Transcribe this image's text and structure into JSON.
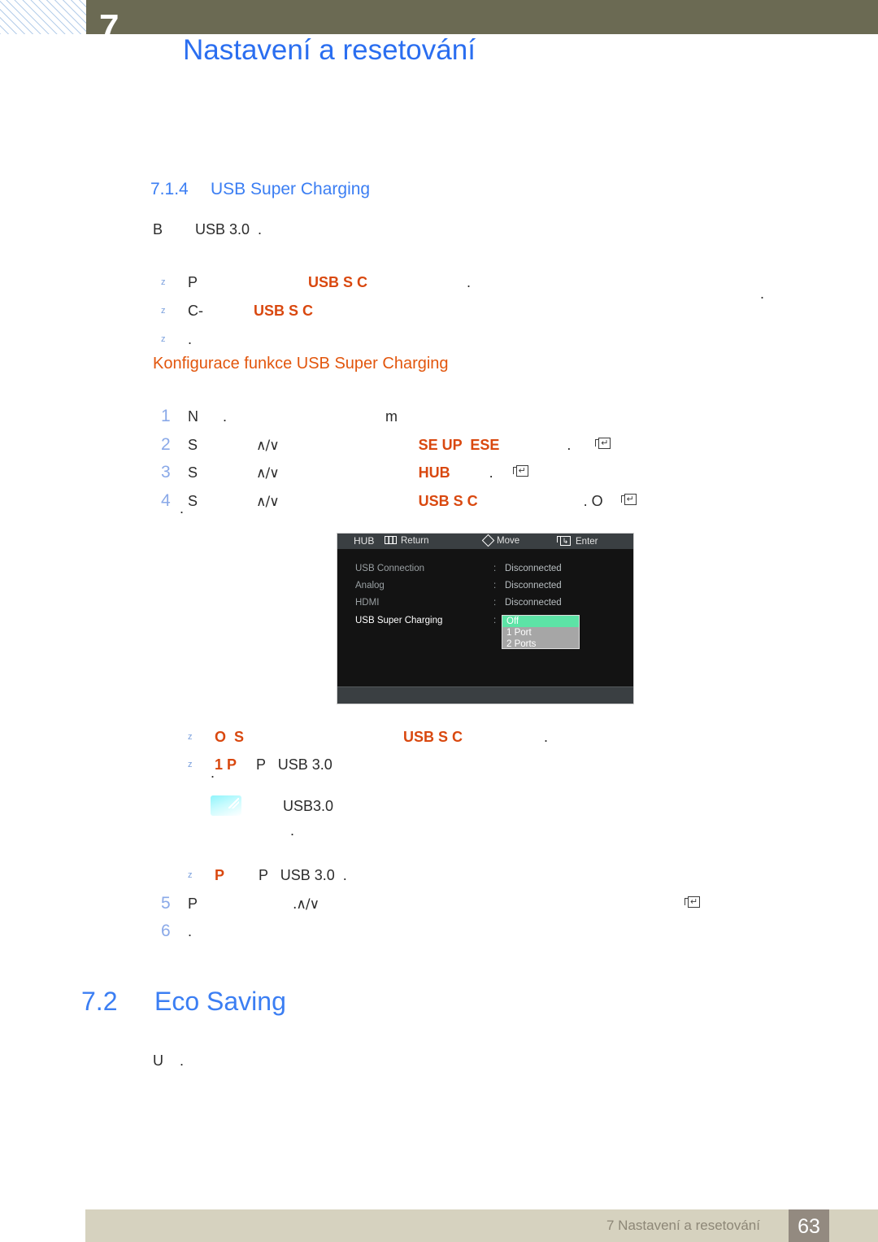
{
  "header": {
    "chapter_number": "7",
    "title": "Nastavení a resetování"
  },
  "section": {
    "number": "7.1.4",
    "title": "USB Super Charging",
    "intro": "B        USB 3.0  ."
  },
  "bullets_top": [
    {
      "mark": "z",
      "pre": "P",
      "accent": "USB S C",
      "post": "."
    },
    {
      "mark": "z",
      "pre": "C-",
      "accent": "USB S C",
      "post": ""
    },
    {
      "mark": "z",
      "pre": "",
      "accent": "",
      "post": "."
    }
  ],
  "bullets_top_tail": {
    "line2_tail": ".",
    "line3_tail": "."
  },
  "procedure": {
    "title": "Konfigurace funkce USB Super Charging",
    "steps": [
      {
        "num": "1",
        "a": "N      .",
        "glyph": "",
        "b": "m",
        "accent": "",
        "tail": "",
        "enter": false
      },
      {
        "num": "2",
        "a": "S",
        "glyph": "∧/∨",
        "b": "",
        "accent": "SE UP  ESE",
        "tail": ".",
        "enter": true
      },
      {
        "num": "3",
        "a": "S",
        "glyph": "∧/∨",
        "b": "",
        "accent": "HUB",
        "tail": ".",
        "enter": true
      },
      {
        "num": "4",
        "a": "S",
        "glyph": "∧/∨",
        "b": "",
        "accent": "USB S C",
        "tail": ". O",
        "enter": true
      },
      {
        "num": "",
        "a": ".",
        "glyph": "",
        "b": "",
        "accent": "",
        "tail": "",
        "enter": false
      }
    ],
    "steps_tail": [
      {
        "num": "5",
        "a": "P",
        "glyph": ".∧/∨",
        "accent": "",
        "tail": "",
        "enter": true
      },
      {
        "num": "6",
        "a": ".",
        "glyph": "",
        "accent": "",
        "tail": "",
        "enter": false
      }
    ]
  },
  "osd": {
    "title": "HUB",
    "rows": [
      {
        "label": "USB Connection",
        "colon": ":",
        "value": "Disconnected",
        "active": false
      },
      {
        "label": "Analog",
        "colon": ":",
        "value": "Disconnected",
        "active": false
      },
      {
        "label": "HDMI",
        "colon": ":",
        "value": "Disconnected",
        "active": false
      },
      {
        "label": "USB Super Charging",
        "colon": ":",
        "value": "",
        "active": true
      }
    ],
    "dropdown": {
      "options": [
        "Off",
        "1 Port",
        "2 Ports"
      ],
      "selected": "Off",
      "highlight_color": "#5de3a6"
    },
    "footer_keys": [
      {
        "icon": "menu-bars-icon",
        "label": "Return"
      },
      {
        "icon": "diamond-dpad-icon",
        "label": "Move"
      },
      {
        "icon": "enter-key-icon",
        "label": "Enter"
      }
    ]
  },
  "bullets_bottom": [
    {
      "mark": "z",
      "pre": "O  S",
      "accent": "USB S C",
      "post": "."
    },
    {
      "mark": "z",
      "pre": "1 P",
      "pre2": "P   USB 3.0",
      "accent": "",
      "post": ""
    },
    {
      "mark": "",
      "pre": ".",
      "accent": "",
      "post": ""
    },
    {
      "mark": "",
      "pre": "USB3.0",
      "accent": "",
      "post": ""
    },
    {
      "mark": "",
      "pre": ".",
      "accent": "",
      "post": ""
    },
    {
      "mark": "z",
      "pre": "P",
      "pre2": "P   USB 3.0  .",
      "accent": "",
      "post": ""
    }
  ],
  "section2": {
    "number": "7.2",
    "title": "Eco Saving",
    "intro": "U    ."
  },
  "footer": {
    "text": "7 Nastavení a resetování",
    "page": "63"
  },
  "colors": {
    "header_band": "#6b6a53",
    "heading_blue": "#3b7ef3",
    "accent_orange": "#d9480f",
    "subtitle_orange": "#e2560d",
    "step_number_blue": "#8aa9e8",
    "footer_bar": "#d6d2bf",
    "footer_page_box": "#938a80"
  }
}
